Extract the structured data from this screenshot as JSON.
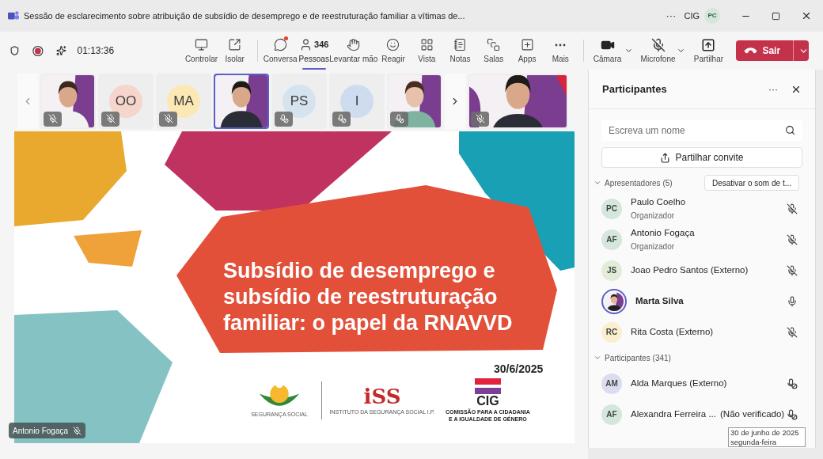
{
  "window": {
    "title": "Sessão de esclarecimento sobre atribuição de subsídio de desemprego e de reestruturação familiar a vítimas de...",
    "more": "···",
    "org": "CIG",
    "account": {
      "initials": "PC",
      "color": "#d5e6dc"
    }
  },
  "toolbar": {
    "timer": "01:13:36",
    "recording": true,
    "items": [
      {
        "label": "Controlar",
        "selected": false
      },
      {
        "label": "Isolar",
        "selected": false
      },
      {
        "label": "Conversa",
        "selected": false,
        "notification": true
      },
      {
        "label": "Pessoas",
        "selected": true,
        "count": "346"
      },
      {
        "label": "Levantar mão",
        "selected": false
      },
      {
        "label": "Reagir",
        "selected": false
      },
      {
        "label": "Vista",
        "selected": false
      },
      {
        "label": "Notas",
        "selected": false
      },
      {
        "label": "Salas",
        "selected": false
      },
      {
        "label": "Apps",
        "selected": false
      },
      {
        "label": "Mais",
        "selected": false
      }
    ],
    "camera": {
      "label": "Câmara"
    },
    "microphone": {
      "label": "Microfone",
      "muted": true
    },
    "share": {
      "label": "Partilhar"
    },
    "leave": {
      "label": "Sair"
    }
  },
  "thumbnails": {
    "items": [
      {
        "kind": "video",
        "muted": true,
        "blocked": false,
        "selected": false
      },
      {
        "kind": "initials",
        "initials": "OO",
        "color": "#f5d5cc",
        "muted": true,
        "blocked": false,
        "selected": false
      },
      {
        "kind": "initials",
        "initials": "MA",
        "color": "#fbe8b5",
        "muted": true,
        "blocked": false,
        "selected": false
      },
      {
        "kind": "video",
        "selected": true
      },
      {
        "kind": "initials",
        "initials": "PS",
        "color": "#d5e3ef",
        "muted": false,
        "blocked": true,
        "selected": false
      },
      {
        "kind": "initials",
        "initials": "I",
        "color": "#cfdcf0",
        "muted": false,
        "blocked": true,
        "selected": false
      },
      {
        "kind": "video",
        "muted": false,
        "blocked": true,
        "selected": false
      }
    ],
    "pinned": {
      "kind": "video",
      "muted": true,
      "blocked": false,
      "selected": false
    }
  },
  "slide": {
    "title": [
      "Subsídio de desemprego e",
      "subsídio de reestruturação",
      "familiar: o papel da RNAVVD"
    ],
    "date": "30/6/2025",
    "logos": [
      {
        "kind": "seguranca",
        "caption": "SEGURANÇA SOCIAL"
      },
      {
        "kind": "iss",
        "mark": "iSS",
        "caption": "INSTITUTO DA SEGURANÇA SOCIAL I.P."
      },
      {
        "kind": "cig",
        "mark": "CIG",
        "caption": [
          "COMISSÃO PARA A CIDADANIA",
          "E A IGUALDADE DE GÉNERO"
        ]
      }
    ]
  },
  "speaker": {
    "name": "Antonio Fogaça",
    "muted": true
  },
  "panel": {
    "title": "Participantes",
    "more": "···",
    "search": {
      "placeholder": "Escreva um nome"
    },
    "invite": "Partilhar convite",
    "groups": [
      {
        "label": "Apresentadores (5)",
        "expanded": true,
        "action": "Desativar o som de t...",
        "people": [
          {
            "initials": "PC",
            "color": "#d5e6dc",
            "name": "Paulo Coelho",
            "role": "Organizador",
            "muted": true,
            "blocked": false,
            "speaking": false
          },
          {
            "initials": "AF",
            "color": "#d5e6dc",
            "name": "Antonio Fogaça",
            "role": "Organizador",
            "muted": true,
            "blocked": false,
            "speaking": false
          },
          {
            "initials": "JS",
            "color": "#e3ecd9",
            "name": "Joao Pedro Santos (Externo)",
            "muted": true,
            "blocked": false,
            "speaking": false
          },
          {
            "name": "Marta Silva",
            "muted": false,
            "blocked": false,
            "speaking": true
          },
          {
            "initials": "RC",
            "color": "#fcefd0",
            "name": "Rita Costa (Externo)",
            "muted": true,
            "blocked": false,
            "speaking": false
          }
        ]
      },
      {
        "label": "Participantes (341)",
        "expanded": true,
        "people": [
          {
            "initials": "AM",
            "color": "#dcdcf0",
            "name": "Alda Marques (Externo)",
            "muted": false,
            "blocked": true,
            "speaking": false
          },
          {
            "initials": "AF",
            "color": "#d5e6dc",
            "name": "Alexandra Ferreira ...",
            "note": "(Não verificado)",
            "muted": false,
            "blocked": true,
            "speaking": false
          }
        ]
      }
    ]
  },
  "tooltip": [
    "30 de junho de 2025",
    "segunda-feira"
  ]
}
